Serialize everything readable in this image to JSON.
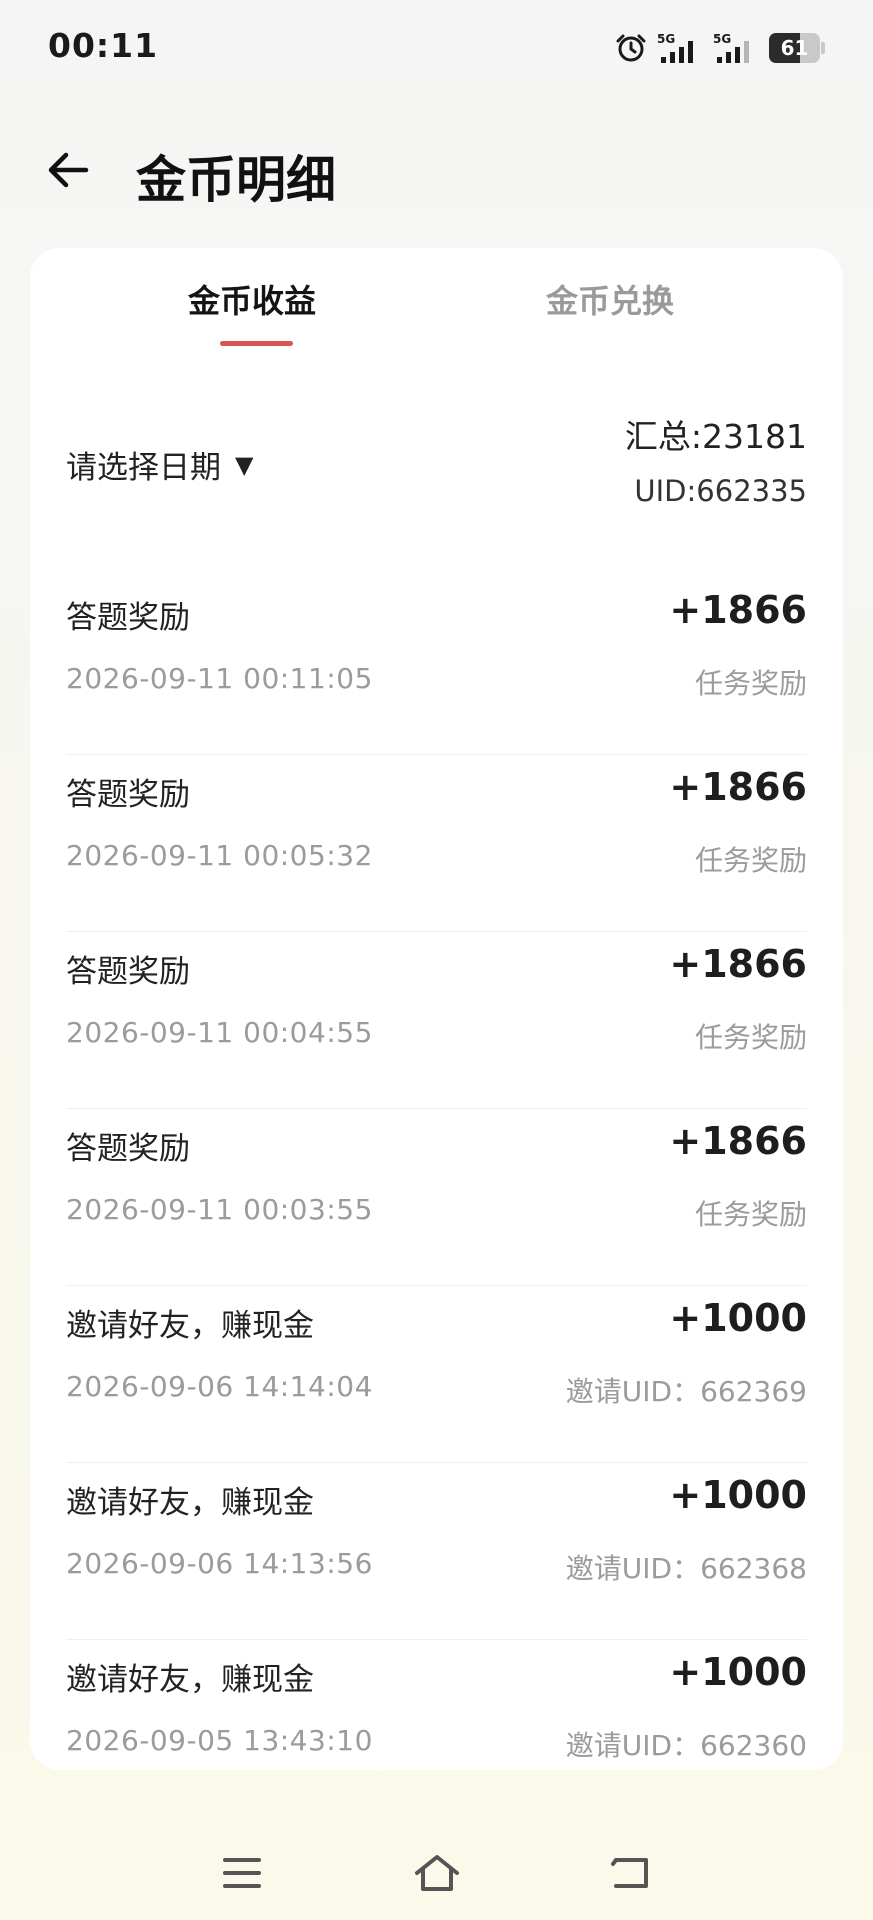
{
  "status_bar": {
    "time": "00:11",
    "net1": "5G",
    "net2": "5G",
    "battery": "61",
    "battery_level": 0.61
  },
  "header": {
    "title": "金币明细",
    "back_icon": "arrow-left-icon"
  },
  "tabs": [
    {
      "label": "金币收益",
      "active": true
    },
    {
      "label": "金币兑换",
      "active": false
    }
  ],
  "filter": {
    "date_placeholder": "请选择日期",
    "dropdown_icon": "▼",
    "total": "汇总:23181",
    "uid": "UID:662335"
  },
  "records": [
    {
      "title": "答题奖励",
      "amount": "+1866",
      "time": "2026-09-11 00:11:05",
      "note": "任务奖励"
    },
    {
      "title": "答题奖励",
      "amount": "+1866",
      "time": "2026-09-11 00:05:32",
      "note": "任务奖励"
    },
    {
      "title": "答题奖励",
      "amount": "+1866",
      "time": "2026-09-11 00:04:55",
      "note": "任务奖励"
    },
    {
      "title": "答题奖励",
      "amount": "+1866",
      "time": "2026-09-11 00:03:55",
      "note": "任务奖励"
    },
    {
      "title": "邀请好友，赚现金",
      "amount": "+1000",
      "time": "2026-09-06 14:14:04",
      "note": "邀请UID：662369"
    },
    {
      "title": "邀请好友，赚现金",
      "amount": "+1000",
      "time": "2026-09-06 14:13:56",
      "note": "邀请UID：662368"
    },
    {
      "title": "邀请好友，赚现金",
      "amount": "+1000",
      "time": "2026-09-05 13:43:10",
      "note": "邀请UID：662360"
    }
  ],
  "colors": {
    "accent": "#d9534f",
    "title": "#111111",
    "muted": "#9b9b9b"
  },
  "nav": {
    "menu_icon": "menu-icon",
    "home_icon": "home-icon",
    "back_icon": "back-icon"
  }
}
